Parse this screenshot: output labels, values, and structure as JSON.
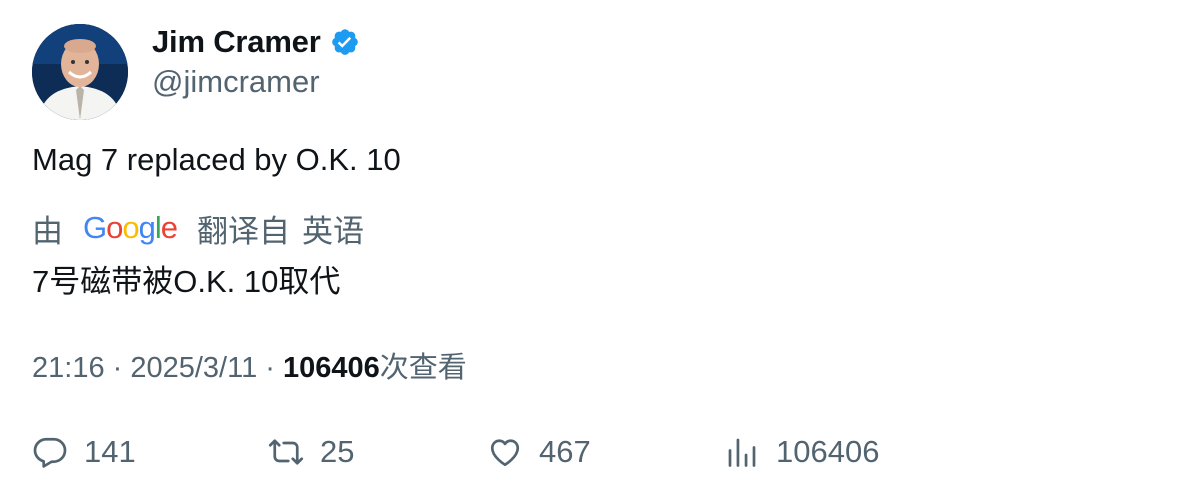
{
  "author": {
    "display_name": "Jim Cramer",
    "handle": "@jimcramer",
    "verified": true
  },
  "tweet": {
    "text": "Mag 7 replaced by O.K. 10"
  },
  "translation": {
    "prefix": "由",
    "provider": [
      "G",
      "o",
      "o",
      "g",
      "l",
      "e"
    ],
    "provider_colors": [
      "#4285F4",
      "#EA4335",
      "#FBBC05",
      "#4285F4",
      "#34A853",
      "#EA4335"
    ],
    "label": "翻译自",
    "language": "英语",
    "text": "7号磁带被O.K. 10取代"
  },
  "meta": {
    "time": "21:16",
    "separator": " · ",
    "date": "2025/3/11",
    "views_count": "106406",
    "views_label": "次查看"
  },
  "actions": {
    "replies": "141",
    "retweets": "25",
    "likes": "467",
    "views": "106406"
  },
  "colors": {
    "verified_badge": "#1d9bf0",
    "secondary_text": "#536471",
    "primary_text": "#0f1419"
  },
  "icons": {
    "reply": "reply-icon",
    "retweet": "retweet-icon",
    "like": "heart-icon",
    "views": "bar-chart-icon",
    "verified": "verified-badge-icon"
  }
}
